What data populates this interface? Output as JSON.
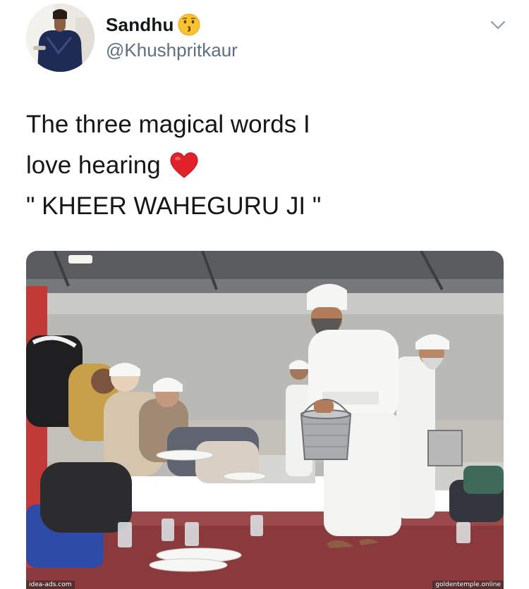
{
  "tweet": {
    "display_name": "Sandhu",
    "handle": "@Khushpritkaur",
    "text_lines": [
      "The three magical words I",
      "love hearing",
      "\" KHEER WAHEGURU JI \""
    ]
  },
  "icons": {
    "name_emoji": "kissing-face-icon",
    "text_emoji": "red-heart-icon",
    "menu": "chevron-down-icon"
  },
  "colors": {
    "handle": "#5b7083",
    "text": "#14171a",
    "heart": "#e0222b",
    "emoji": "#f9c22e",
    "carpet": "#8a3a3c"
  },
  "photo": {
    "watermark_left": "idea-ads.com",
    "watermark_right": "goldentemple.online"
  }
}
